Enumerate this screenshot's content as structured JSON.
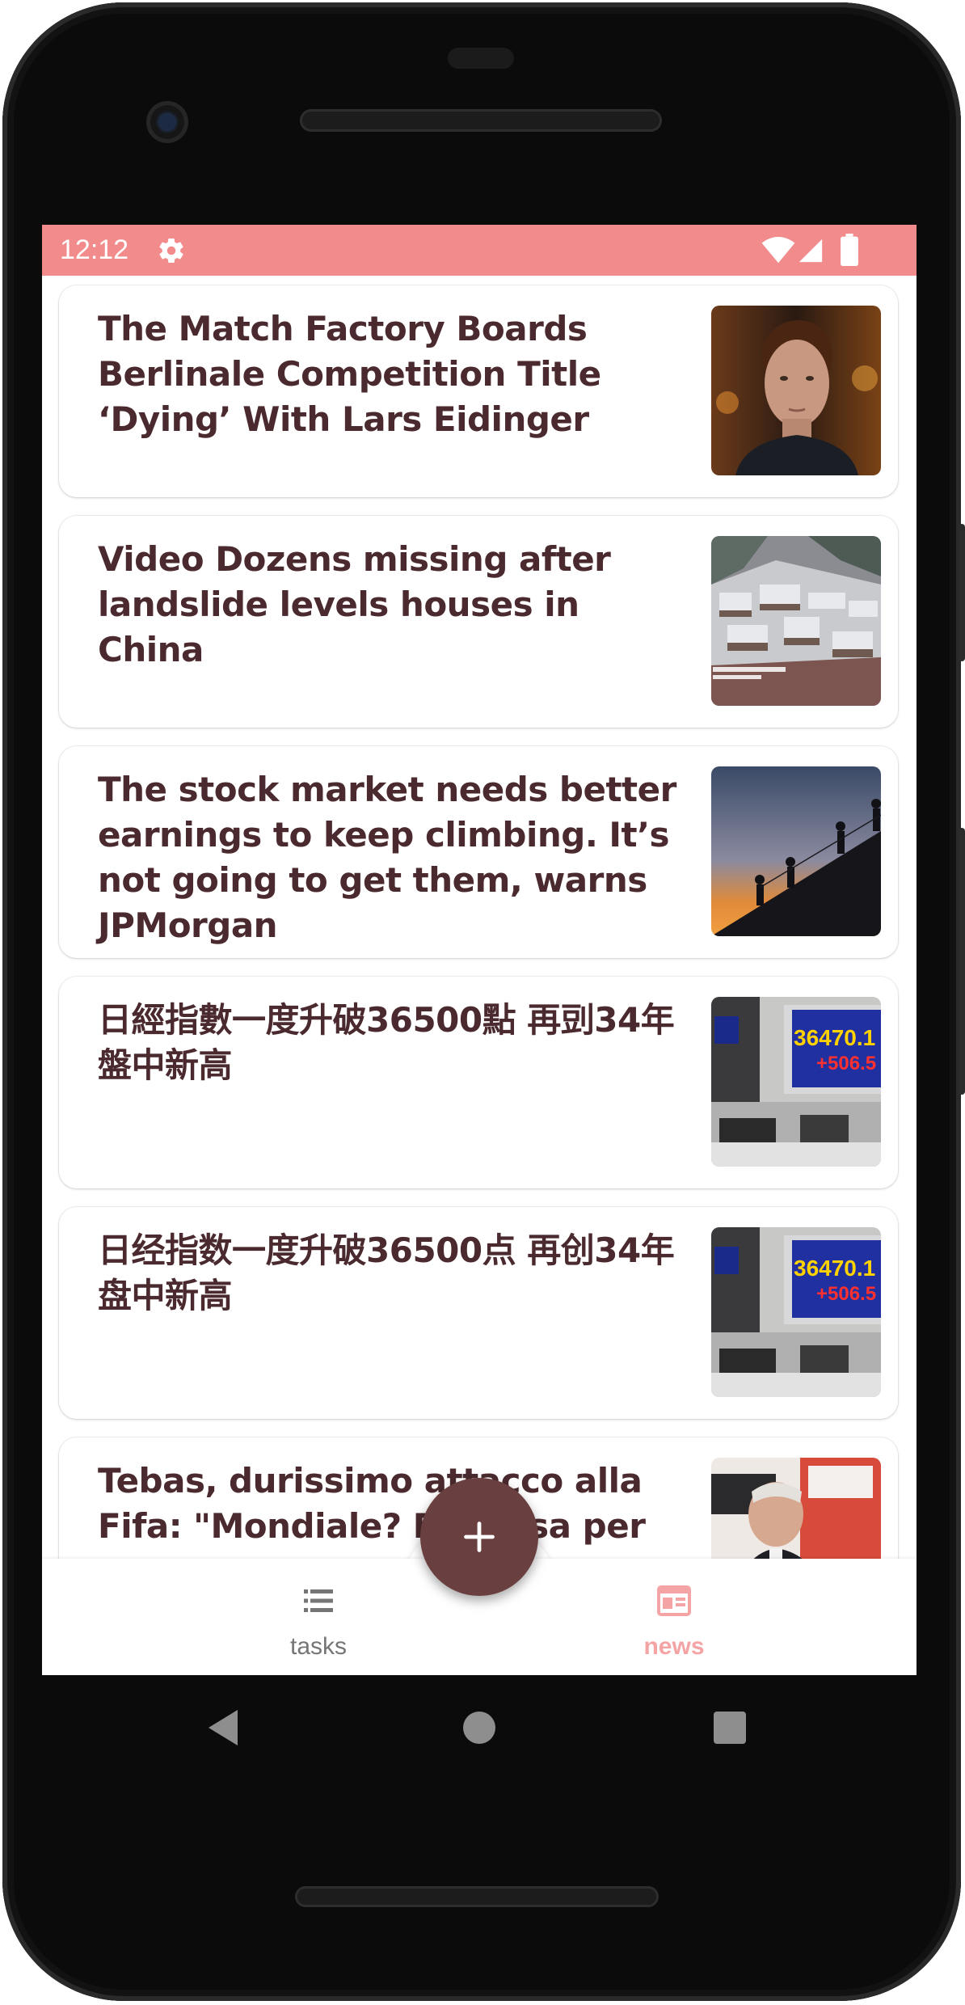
{
  "status_bar": {
    "time": "12:12",
    "background": "#f28b8b",
    "icons": [
      "gear-icon",
      "wifi-icon",
      "signal-icon",
      "battery-icon"
    ]
  },
  "feed": {
    "items": [
      {
        "title": "The Match Factory Boards Berlinale Competition Title ‘Dying’ With Lars Eidinger",
        "thumbnail": "portrait-photo"
      },
      {
        "title": "Video Dozens missing after landslide levels houses in China",
        "thumbnail": "snowy-village-photo"
      },
      {
        "title": "The stock market needs better earnings to keep climbing. It’s not going to get them, warns JPMorgan",
        "thumbnail": "climbers-sunset-photo"
      },
      {
        "title": "日經指數一度升破36500點 再剅34年盤中新高",
        "thumbnail": "stock-board-photo"
      },
      {
        "title": "日经指数一度升破36500点 再创34年盘中新高",
        "thumbnail": "stock-board-photo"
      },
      {
        "title": "Tebas, durissimo attacco alla Fifa: \"Mondiale? Fa... usa per",
        "thumbnail": "speaker-photo"
      }
    ],
    "stock_board_text": [
      "36470.1",
      "+506.5"
    ]
  },
  "bottom_nav": {
    "items": [
      {
        "label": "tasks",
        "icon": "list-icon",
        "active": false,
        "color": "#757575"
      },
      {
        "label": "news",
        "icon": "newspaper-icon",
        "active": true,
        "color": "#f4a4a4"
      }
    ],
    "fab": {
      "icon": "plus-icon",
      "color": "#6a3f3f"
    }
  },
  "system_nav": [
    "back-icon",
    "home-icon",
    "recents-icon"
  ],
  "colors": {
    "accent": "#f28b8b",
    "title_text": "#4a2a2e"
  }
}
